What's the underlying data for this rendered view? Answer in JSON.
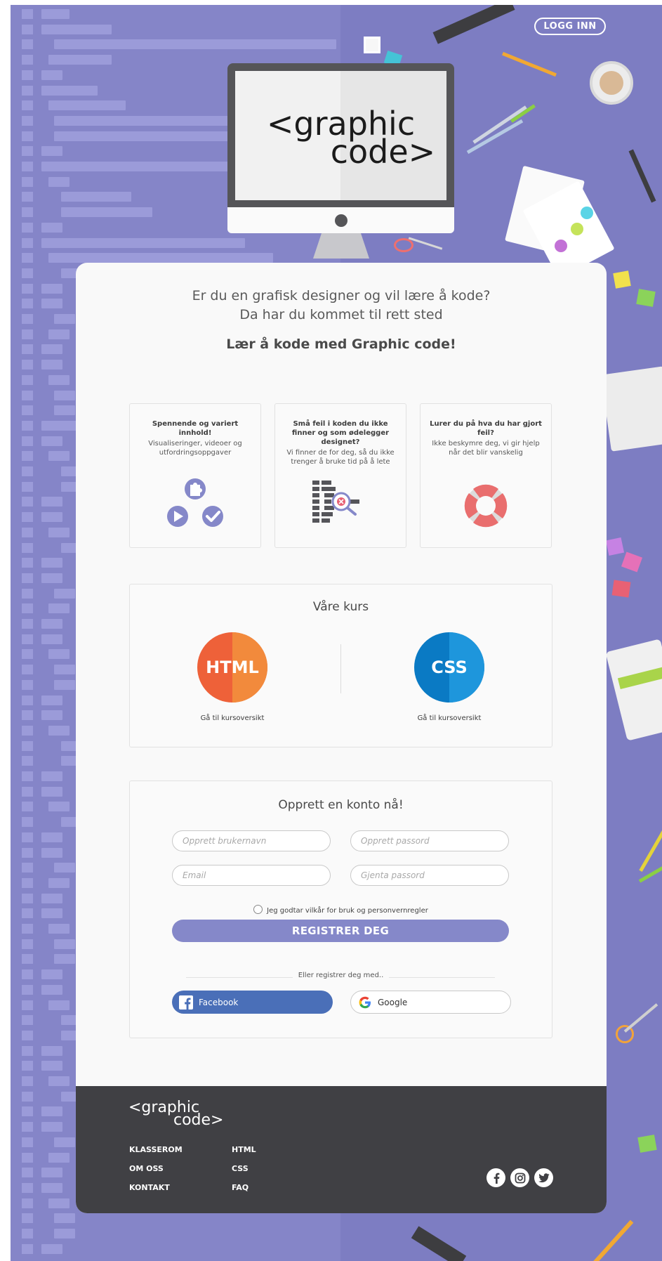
{
  "header": {
    "login_label": "LOGG INN"
  },
  "brand": {
    "logo_line1": "<graphic",
    "logo_line2": "code>"
  },
  "hero": {
    "line1": "Er du en grafisk designer og vil lære å kode?",
    "line2": "Da har du kommet til rett sted",
    "tagline": "Lær å kode med Graphic code!"
  },
  "features": [
    {
      "title": "Spennende og variert innhold!",
      "text": "Visualiseringer, videoer og utfordringsoppgaver",
      "icon": "puzzle-play-check-icon"
    },
    {
      "title": "Små feil i koden du ikke finner og som ødelegger designet?",
      "text": "Vi finner de for deg, så du ikke trenger å bruke tid på å lete",
      "icon": "code-search-icon"
    },
    {
      "title": "Lurer du på hva du har gjort feil?",
      "text": "Ikke beskymre deg, vi gir hjelp når det blir vanskelig",
      "icon": "lifebuoy-icon"
    }
  ],
  "courses": {
    "title": "Våre kurs",
    "items": [
      {
        "label": "HTML",
        "link": "Gå til kursoversikt",
        "color": "#ee6139",
        "color2": "#f28a3c"
      },
      {
        "label": "CSS",
        "link": "Gå til kursoversikt",
        "color": "#0a7ac4",
        "color2": "#1e96dc"
      }
    ]
  },
  "signup": {
    "title": "Opprett en konto nå!",
    "username_placeholder": "Opprett brukernavn",
    "password_placeholder": "Opprett passord",
    "email_placeholder": "Email",
    "repeat_password_placeholder": "Gjenta passord",
    "terms": "Jeg godtar vilkår for bruk og personvernregler",
    "register_label": "REGISTRER DEG",
    "or_text": "Eller registrer deg med..",
    "facebook_label": "Facebook",
    "google_label": "Google"
  },
  "footer": {
    "links_col1": [
      "KLASSEROM",
      "OM OSS",
      "KONTAKT"
    ],
    "links_col2": [
      "HTML",
      "CSS",
      "FAQ"
    ],
    "social": [
      "facebook-icon",
      "instagram-icon",
      "twitter-icon"
    ]
  },
  "colors": {
    "background": "#8585c8",
    "accent": "#8588c9",
    "footer": "#404044",
    "facebook": "#4a6fb8"
  }
}
